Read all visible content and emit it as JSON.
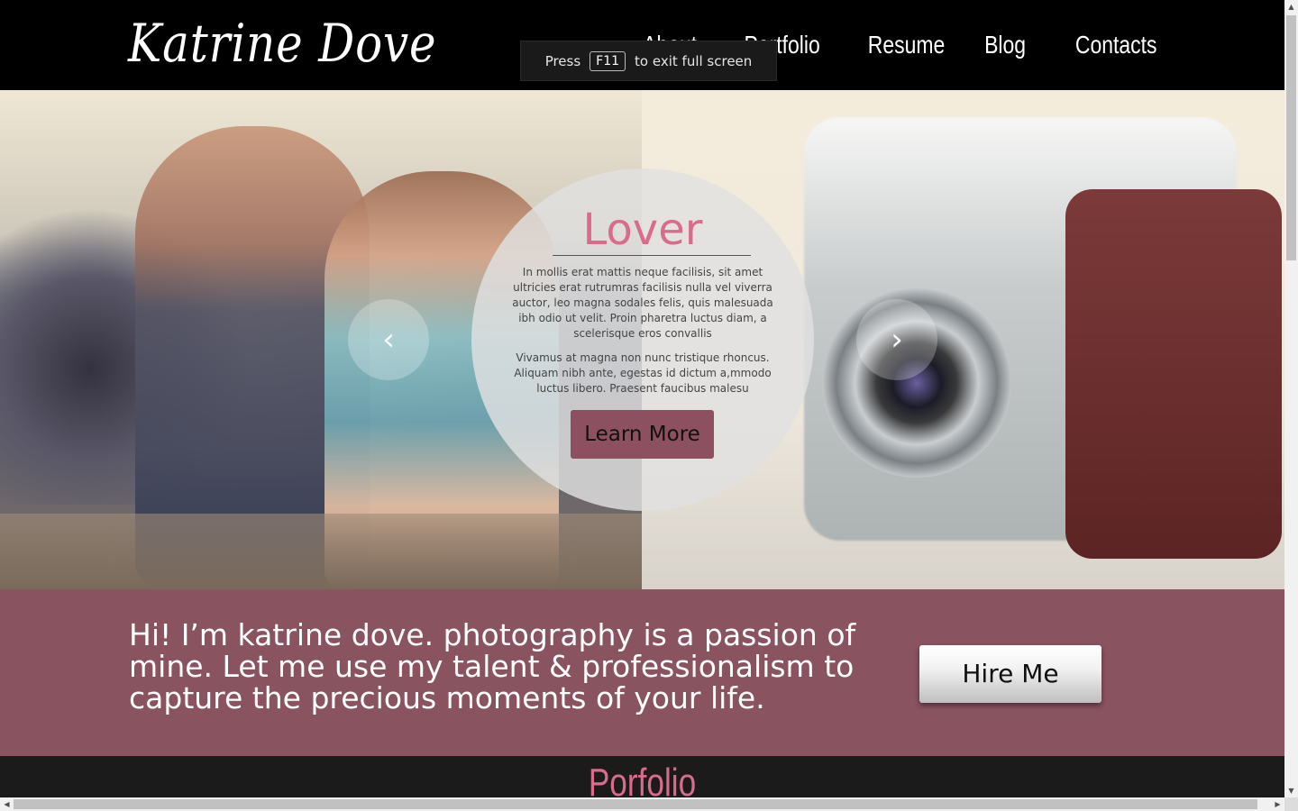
{
  "header": {
    "logo": "Katrine Dove",
    "nav": [
      "About",
      "Portfolio",
      "Resume",
      "Blog",
      "Contacts"
    ]
  },
  "fullscreen_toast": {
    "before": "Press",
    "key": "F11",
    "after": "to exit full screen"
  },
  "hero": {
    "prev_icon": "‹",
    "next_icon": "›",
    "caption": {
      "title": "Lover",
      "p1": "In mollis erat mattis neque facilisis, sit amet ultricies erat rutrumras facilisis nulla vel viverra auctor, leo magna sodales felis, quis malesuada ibh odio ut velit. Proin pharetra luctus diam, a scelerisque eros convallis",
      "p2": "Vivamus at magna non nunc tristique rhoncus. Aliquam nibh ante, egestas id dictum a,mmodo luctus libero. Praesent faucibus malesu",
      "button": "Learn More"
    }
  },
  "intro": {
    "text": "Hi! I’m katrine dove. photography is a passion of mine. Let me use my talent & professionalism to capture the precious moments of your life.",
    "button": "Hire Me"
  },
  "portfolio": {
    "title": "Porfolio"
  },
  "scrollbars": {
    "up": "▲",
    "down": "▼",
    "left": "◀",
    "right": "▶"
  },
  "colors": {
    "accent_pink": "#d96b8c",
    "band_mauve": "#8a5360",
    "button_mauve": "#8c5060",
    "header_bg": "#000000"
  }
}
